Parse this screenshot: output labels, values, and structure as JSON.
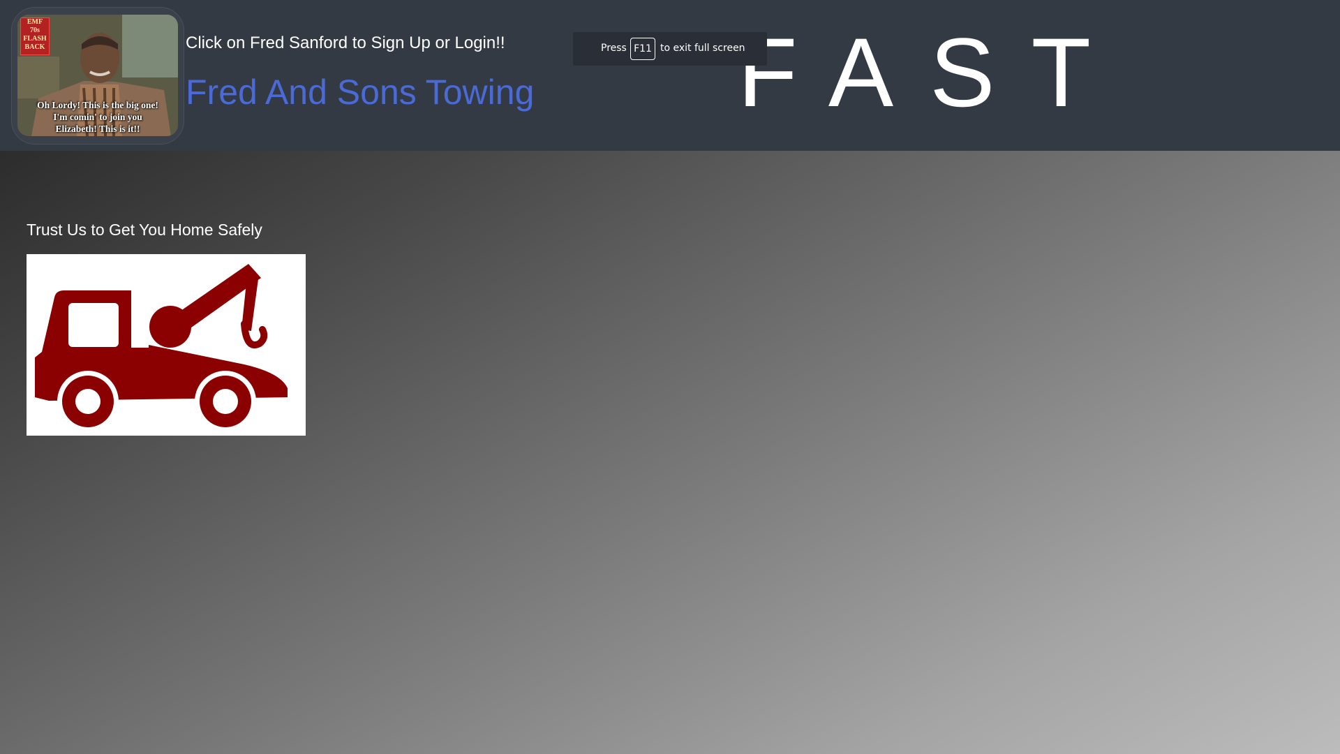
{
  "header": {
    "avatar": {
      "badge_lines": [
        "EMF",
        "70s",
        "FLASH",
        "BACK"
      ],
      "caption": "Oh Lordy! This is the big one!\nI'm comin' to join you\nElizabeth! This is it!!"
    },
    "signup_prompt": "Click on Fred Sanford to Sign Up or Login!!",
    "brand_name": "Fred And Sons Towing",
    "fast_word": "FAST"
  },
  "fullscreen_notice": {
    "press": "Press",
    "key": "F11",
    "rest": "to exit full screen"
  },
  "main": {
    "tagline": "Trust Us to Get You Home Safely",
    "tow_truck_icon": "tow-truck-icon",
    "tow_truck_color": "#8b0000"
  },
  "colors": {
    "header_bg": "#343a44",
    "brand_blue": "#4a6ad8"
  }
}
